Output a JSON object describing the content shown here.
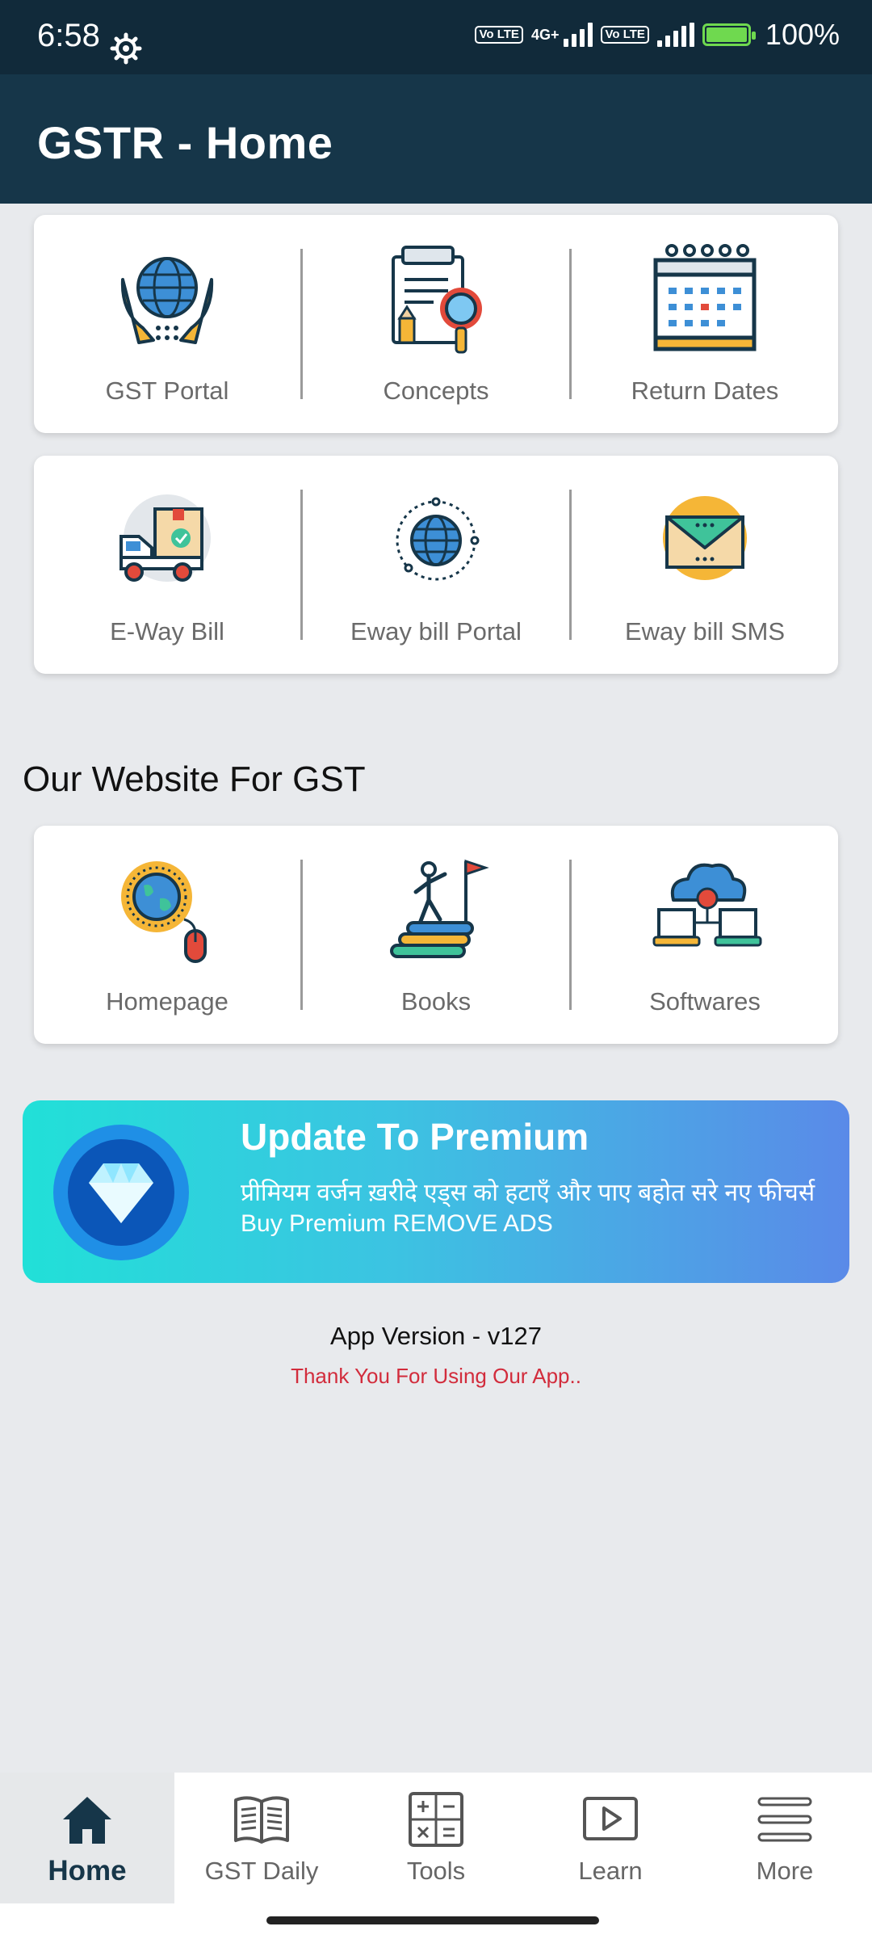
{
  "status_bar": {
    "time": "6:58",
    "lte1": "Vo LTE",
    "net": "4G+",
    "lte2": "Vo LTE",
    "battery": "100%",
    "battery_level": 1.0
  },
  "app_bar": {
    "title": "GSTR - Home"
  },
  "grid1": {
    "items": [
      {
        "label": "GST Portal",
        "icon": "globe-hands-icon"
      },
      {
        "label": "Concepts",
        "icon": "document-search-icon"
      },
      {
        "label": "Return Dates",
        "icon": "calendar-icon"
      }
    ]
  },
  "grid2": {
    "items": [
      {
        "label": "E-Way Bill",
        "icon": "delivery-truck-icon"
      },
      {
        "label": "Eway bill Portal",
        "icon": "globe-icon"
      },
      {
        "label": "Eway bill SMS",
        "icon": "envelope-icon"
      }
    ]
  },
  "website_section": {
    "title": "Our Website For GST",
    "items": [
      {
        "label": "Homepage",
        "icon": "globe-mouse-icon"
      },
      {
        "label": "Books",
        "icon": "books-climb-icon"
      },
      {
        "label": "Softwares",
        "icon": "cloud-devices-icon"
      }
    ]
  },
  "premium": {
    "title": "Update To Premium",
    "hindi_text": "प्रीमियम वर्जन ख़रीदे एड्स को हटाएँ और पाए बहोत सरे नए फीचर्स",
    "subtitle": "Buy Premium REMOVE ADS",
    "icon": "diamond-icon"
  },
  "footer": {
    "version": "App Version - v127",
    "thanks": "Thank You For Using Our App.."
  },
  "bottom_nav": {
    "items": [
      {
        "label": "Home",
        "icon": "home-icon",
        "active": true
      },
      {
        "label": "GST Daily",
        "icon": "book-open-icon",
        "active": false
      },
      {
        "label": "Tools",
        "icon": "calculator-icon",
        "active": false
      },
      {
        "label": "Learn",
        "icon": "play-icon",
        "active": false
      },
      {
        "label": "More",
        "icon": "menu-icon",
        "active": false
      }
    ]
  },
  "colors": {
    "status_bar": "#112a3a",
    "app_bar": "#163649",
    "background": "#e8eaed",
    "thanks_text": "#d22c3c",
    "premium_gradient_start": "#21e0d8",
    "premium_gradient_end": "#5a8ae8"
  }
}
